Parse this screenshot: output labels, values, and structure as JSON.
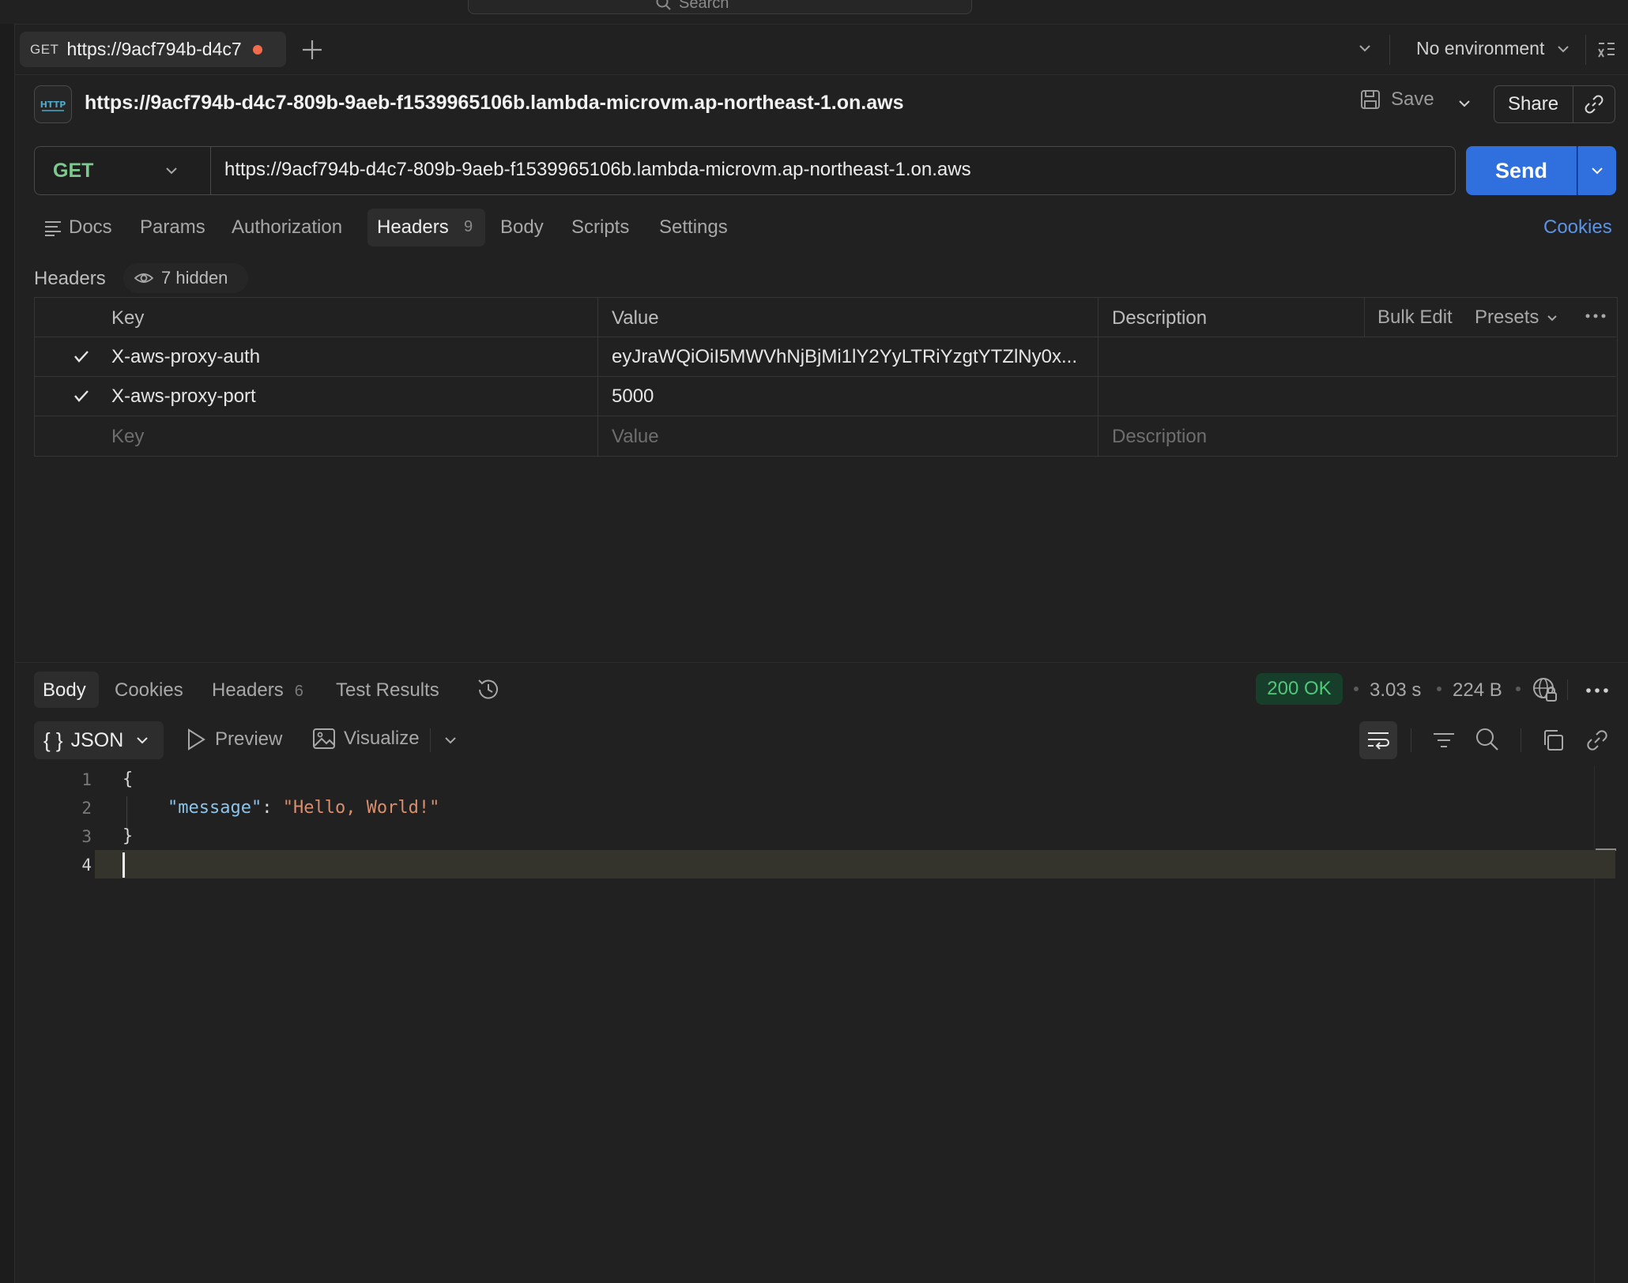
{
  "top_search": {
    "placeholder": "Search"
  },
  "tab": {
    "method": "GET",
    "name": "https://9acf794b-d4c7",
    "unsaved": true
  },
  "environment": {
    "label": "No environment"
  },
  "request": {
    "title": "https://9acf794b-d4c7-809b-9aeb-f1539965106b.lambda-microvm.ap-northeast-1.on.aws",
    "method": "GET",
    "url": "https://9acf794b-d4c7-809b-9aeb-f1539965106b.lambda-microvm.ap-northeast-1.on.aws",
    "save_label": "Save",
    "share_label": "Share",
    "send_label": "Send",
    "http_badge": "HTTP"
  },
  "request_tabs": {
    "docs": "Docs",
    "params": "Params",
    "authorization": "Authorization",
    "headers": "Headers",
    "headers_count": "9",
    "body": "Body",
    "scripts": "Scripts",
    "settings": "Settings",
    "cookies": "Cookies",
    "active": "Headers"
  },
  "headers_section": {
    "title": "Headers",
    "hidden_label": "7 hidden",
    "columns": {
      "key": "Key",
      "value": "Value",
      "description": "Description"
    },
    "bulk_edit": "Bulk Edit",
    "presets": "Presets",
    "rows": [
      {
        "checked": true,
        "key": "X-aws-proxy-auth",
        "value": "eyJraWQiOiI5MWVhNjBjMi1lY2YyLTRiYzgtYTZlNy0x...",
        "description": ""
      },
      {
        "checked": true,
        "key": "X-aws-proxy-port",
        "value": "5000",
        "description": ""
      }
    ],
    "placeholders": {
      "key": "Key",
      "value": "Value",
      "description": "Description"
    }
  },
  "response": {
    "tabs": {
      "body": "Body",
      "cookies": "Cookies",
      "headers": "Headers",
      "headers_count": "6",
      "test_results": "Test Results",
      "active": "Body"
    },
    "status": "200 OK",
    "time": "3.03 s",
    "size": "224 B",
    "format": "JSON",
    "format_icon": "{ }",
    "preview_label": "Preview",
    "visualize_label": "Visualize",
    "code_lines": [
      {
        "n": "1",
        "open": "{"
      },
      {
        "n": "2",
        "key": "\"message\"",
        "colon": ": ",
        "value": "\"Hello, World!\""
      },
      {
        "n": "3",
        "close": "}"
      },
      {
        "n": "4"
      }
    ]
  },
  "colors": {
    "background": "#212121",
    "accent_blue": "#2f6fde",
    "method_get": "#7ec98f",
    "status_ok": "#4fc87a",
    "json_key": "#8fc3e8",
    "json_string": "#d98e6d",
    "unsaved_dot": "#f26b4b"
  }
}
